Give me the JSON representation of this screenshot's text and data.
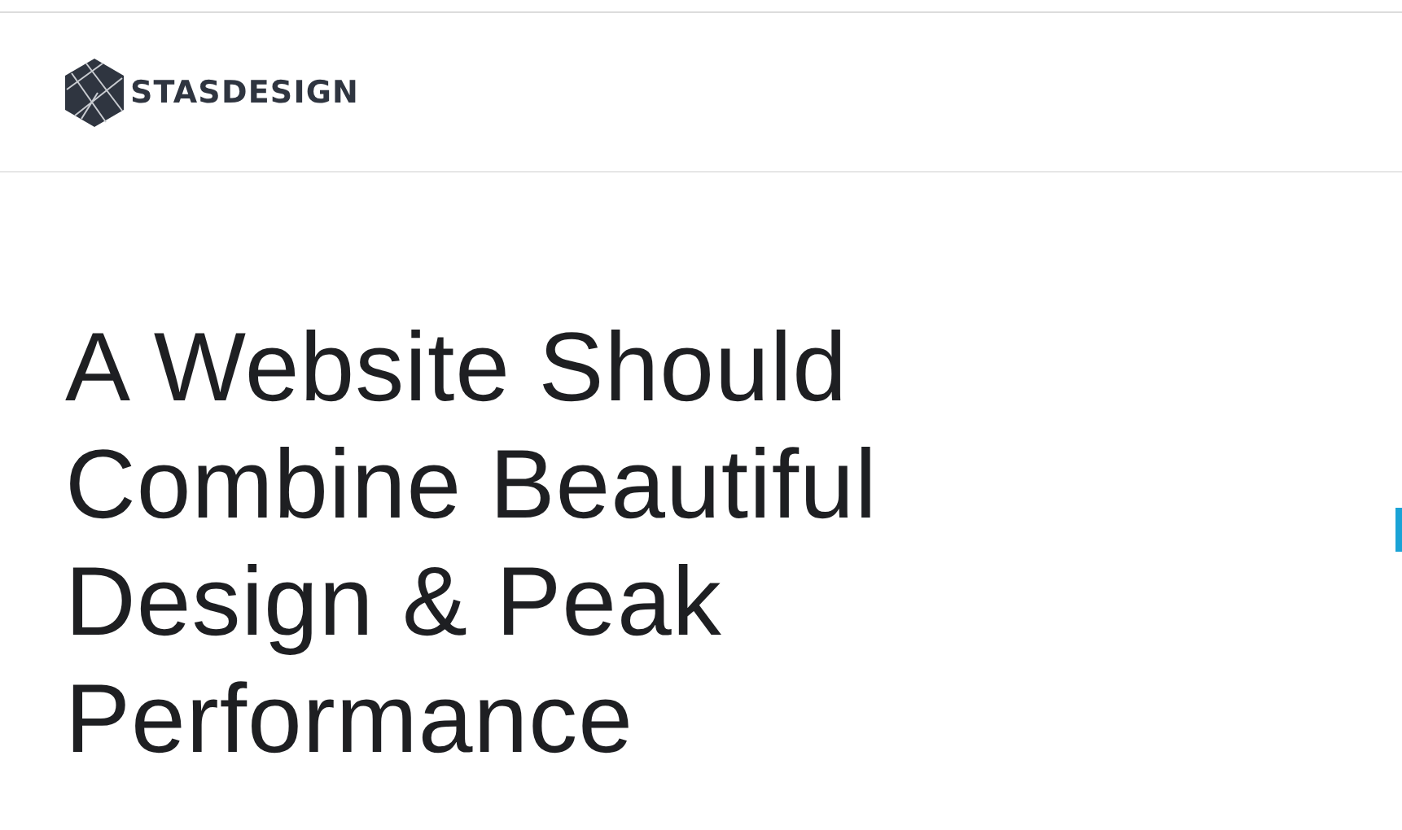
{
  "header": {
    "logo_text": "STASDESIGN"
  },
  "hero": {
    "heading_lines": [
      "A Website Should",
      "Combine Beautiful",
      "Design & Peak",
      "Performance"
    ]
  }
}
